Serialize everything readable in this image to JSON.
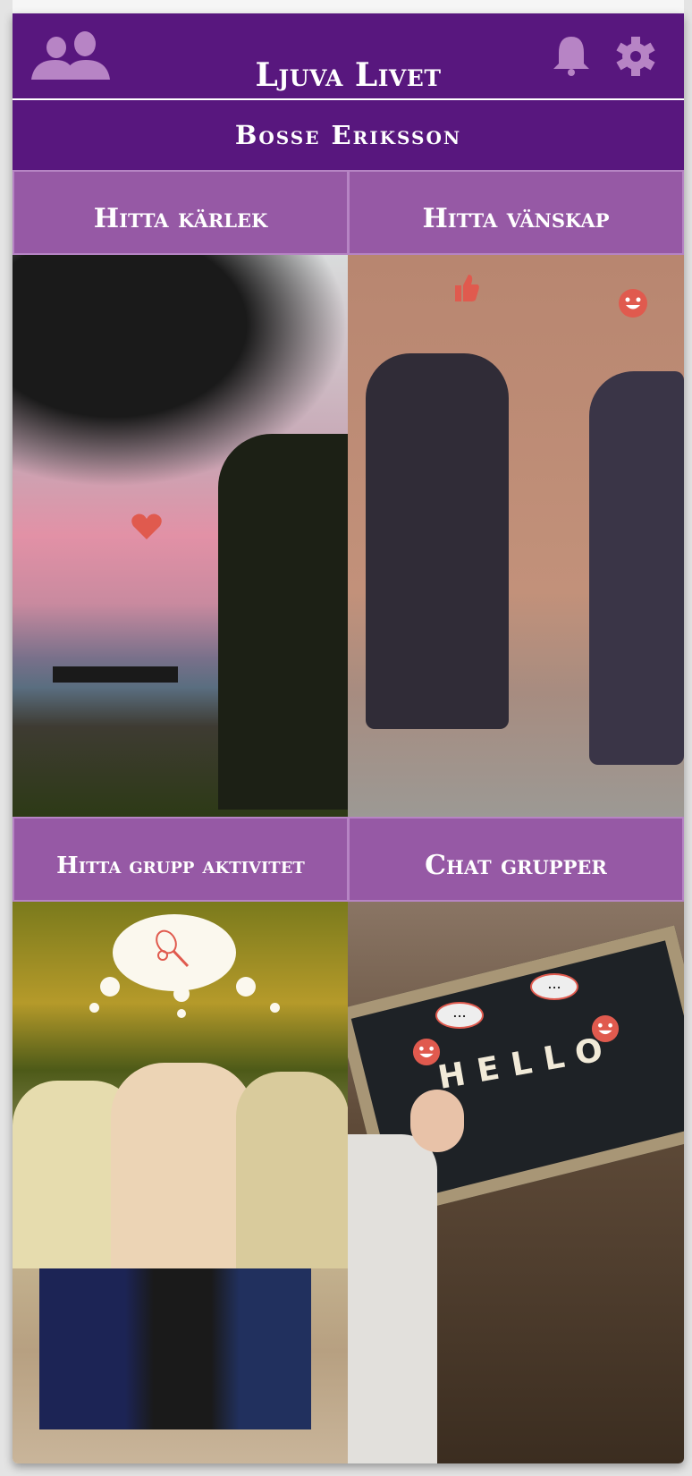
{
  "header": {
    "title": "Ljuva Livet",
    "icons": [
      "users-icon",
      "bell-icon",
      "gear-icon"
    ]
  },
  "user": {
    "name": "Bosse Eriksson"
  },
  "tiles": [
    {
      "label": "Hitta kärlek",
      "image": "couple-on-bench-sunset",
      "icon": "heart-icon"
    },
    {
      "label": "Hitta vänskap",
      "image": "elderly-couple-talking",
      "icon": "thumbs-up-icon"
    },
    {
      "label": "Hitta grupp aktivitet",
      "image": "seniors-walking",
      "icon": "ping-pong-icon"
    },
    {
      "label": "Chat grupper",
      "image": "hello-chalkboard",
      "icon": "chat-bubble-icon"
    }
  ],
  "photo_text": {
    "hello": "HELLO",
    "dots": "..."
  },
  "colors": {
    "header": "#58177e",
    "tile": "#9659a5",
    "icon": "#b784c5",
    "accent": "#e05a4e"
  }
}
